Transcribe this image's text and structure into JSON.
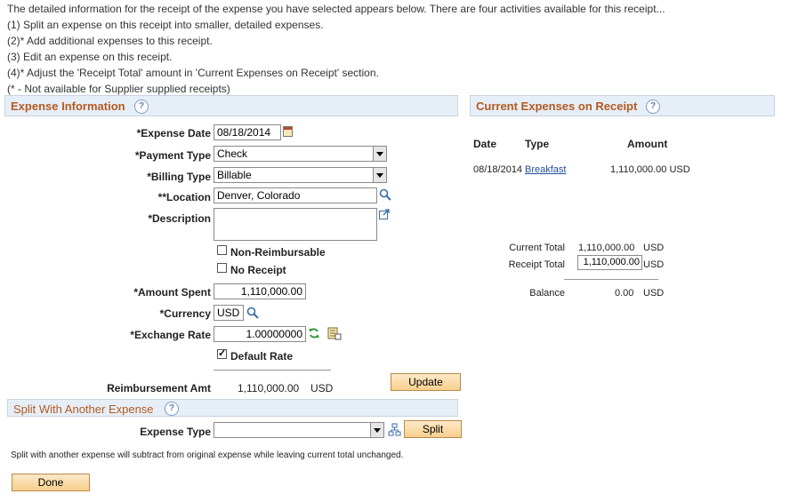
{
  "intro": {
    "lines": [
      "The detailed information for the receipt of the expense you have selected appears below. There are four activities available for this receipt...",
      "(1) Split an expense on this receipt into smaller, detailed expenses.",
      "(2)* Add additional expenses to this receipt.",
      "(3) Edit an expense on this receipt.",
      "(4)* Adjust the 'Receipt Total' amount in 'Current Expenses on Receipt' section.",
      "(* - Not available for Supplier supplied receipts)"
    ]
  },
  "expense_info": {
    "title": "Expense Information",
    "help": "?",
    "expense_date": {
      "label": "*Expense Date",
      "value": "08/18/2014"
    },
    "payment_type": {
      "label": "*Payment Type",
      "value": "Check"
    },
    "billing_type": {
      "label": "*Billing Type",
      "value": "Billable"
    },
    "location": {
      "label": "**Location",
      "value": "Denver, Colorado"
    },
    "description": {
      "label": "*Description",
      "value": ""
    },
    "non_reimbursable": {
      "label": "Non-Reimbursable",
      "checked": false
    },
    "no_receipt": {
      "label": "No Receipt",
      "checked": false
    },
    "amount_spent": {
      "label": "*Amount Spent",
      "value": "1,110,000.00"
    },
    "currency": {
      "label": "*Currency",
      "value": "USD"
    },
    "exchange_rate": {
      "label": "*Exchange Rate",
      "value": "1.00000000"
    },
    "default_rate": {
      "label": "Default Rate",
      "checked": true,
      "mark": "✓"
    },
    "reimbursement": {
      "label": "Reimbursement Amt",
      "value": "1,110,000.00",
      "currency": "USD"
    },
    "update_button": "Update"
  },
  "current_expenses": {
    "title": "Current Expenses on Receipt",
    "help": "?",
    "headers": {
      "date": "Date",
      "type": "Type",
      "amount": "Amount"
    },
    "row": {
      "date": "08/18/2014",
      "type": "Breakfast",
      "amount": "1,110,000.00 USD"
    },
    "current_total": {
      "label": "Current Total",
      "value": "1,110,000.00",
      "currency": "USD"
    },
    "receipt_total": {
      "label": "Receipt Total",
      "value": "1,110,000.00",
      "currency": "USD"
    },
    "balance": {
      "label": "Balance",
      "value": "0.00",
      "currency": "USD"
    }
  },
  "split": {
    "title": "Split With Another Expense",
    "help": "?",
    "expense_type": {
      "label": "Expense Type",
      "value": ""
    },
    "split_button": "Split",
    "note": "Split with another expense will subtract from original expense while leaving current total unchanged."
  },
  "done_button": "Done",
  "colors": {
    "section_title": "#b35a1f",
    "section_bg": "#e6eef8",
    "button_bg": "#f7cf8d",
    "link": "#1f4e9a"
  }
}
